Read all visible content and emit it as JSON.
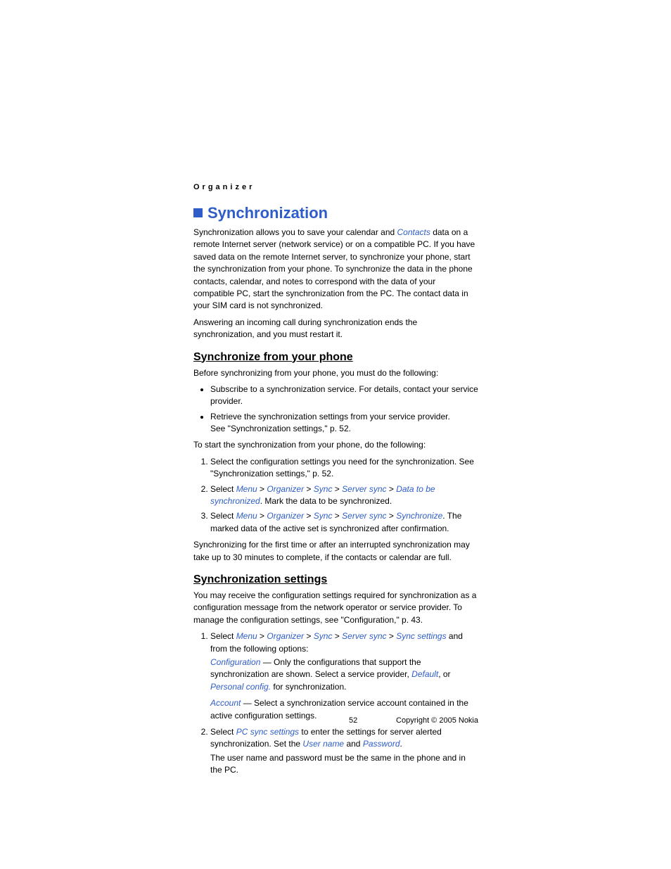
{
  "header": {
    "category": "Organizer"
  },
  "main": {
    "h1": "Synchronization",
    "intro1_a": "Synchronization allows you to save your calendar and ",
    "intro1_link": "Contacts",
    "intro1_b": " data on a remote Internet server (network service) or on a compatible PC. If you have saved data on the remote Internet server, to synchronize your phone, start the synchronization from your phone. To synchronize the data in the phone contacts, calendar, and notes to correspond with the data of your compatible PC, start the synchronization from the PC. The contact data in your SIM card is not synchronized.",
    "intro2": "Answering an incoming call during synchronization ends the synchronization, and you must restart it.",
    "sec1": {
      "h2": "Synchronize from your phone",
      "p1": "Before synchronizing from your phone, you must do the following:",
      "b1": "Subscribe to a synchronization service. For details, contact your service provider.",
      "b2a": "Retrieve the synchronization settings from your service provider.",
      "b2b": "See \"Synchronization settings,\" p. 52.",
      "p2": "To start the synchronization from your phone, do the following:",
      "o1": "Select the configuration settings you need for the synchronization. See \"Synchronization settings,\" p. 52.",
      "o2_pre": "Select ",
      "o2_menu": "Menu",
      "gt": " > ",
      "o2_org": "Organizer",
      "o2_sync": "Sync",
      "o2_ss": "Server sync",
      "o2_dtbs": "Data to be synchronized",
      "o2_post": ". Mark the data to be synchronized.",
      "o3_pre": "Select ",
      "o3_syncword": "Synchronize",
      "o3_post": ". The marked data of the active set is synchronized after confirmation.",
      "p3": "Synchronizing for the first time or after an interrupted synchronization may take up to 30 minutes to complete, if the contacts or calendar are full."
    },
    "sec2": {
      "h2": "Synchronization settings",
      "p1": "You may receive the configuration settings required for synchronization as a configuration message from the network operator or service provider. To manage the configuration settings, see \"Configuration,\" p. 43.",
      "o1_pre": "Select ",
      "o1_sset": "Sync settings",
      "o1_post": " and from the following options:",
      "cfg_link": "Configuration",
      "cfg_txt_a": " — Only the configurations that support the synchronization are shown. Select a service provider, ",
      "cfg_def": "Default",
      "cfg_txt_b": ", or ",
      "cfg_pc": "Personal config.",
      "cfg_txt_c": " for synchronization.",
      "acc_link": "Account",
      "acc_txt": " — Select a synchronization service account contained in the active configuration settings.",
      "o2_pre": "Select ",
      "o2_pcs": "PC sync settings",
      "o2_mid": " to enter the settings for server alerted synchronization. Set the ",
      "o2_un": "User name",
      "o2_and": " and ",
      "o2_pw": "Password",
      "o2_dot": ".",
      "o2_note": "The user name and password must be the same in the phone and in the PC."
    }
  },
  "footer": {
    "page": "52",
    "copyright": "Copyright © 2005 Nokia"
  }
}
